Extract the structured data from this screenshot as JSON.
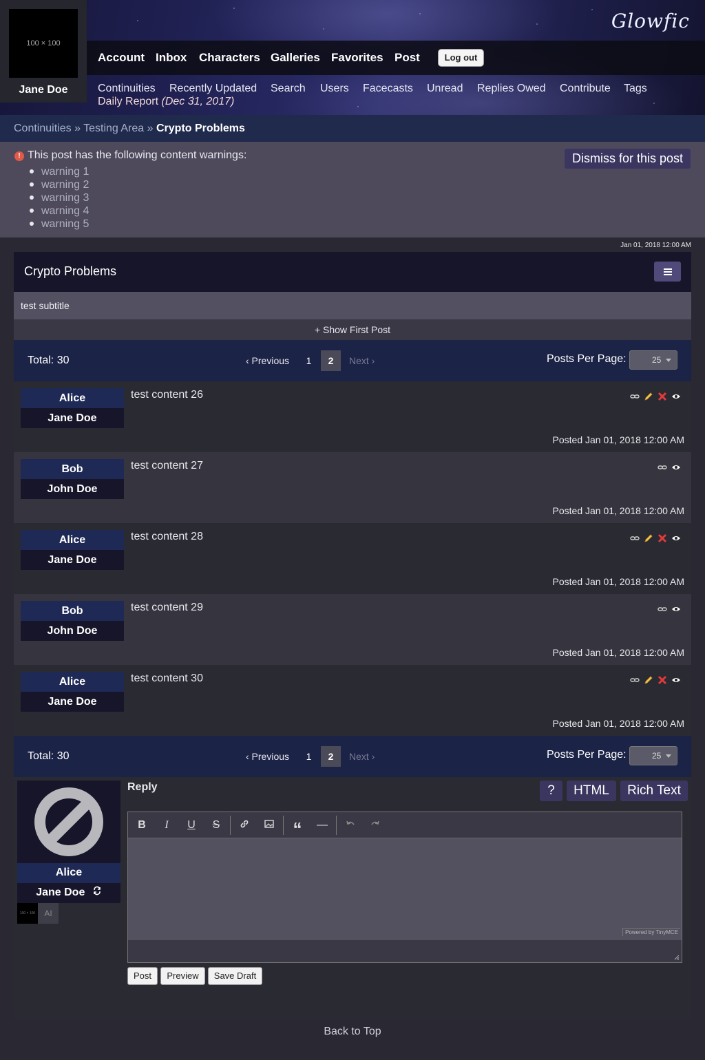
{
  "header": {
    "logo": "Glowfic",
    "avatar_placeholder": "100 × 100",
    "username": "Jane Doe",
    "main_nav": [
      "Account",
      "Inbox",
      "Characters",
      "Galleries",
      "Favorites",
      "Post"
    ],
    "logout_label": "Log out",
    "sub_nav": [
      "Continuities",
      "Recently Updated",
      "Search",
      "Users",
      "Facecasts",
      "Unread",
      "Replies Owed",
      "Contribute",
      "Tags"
    ],
    "daily_report": "Daily Report",
    "daily_report_date": "(Dec 31, 2017)"
  },
  "breadcrumb": {
    "items": [
      "Continuities",
      "Testing Area"
    ],
    "separator": "»",
    "current": "Crypto Problems"
  },
  "warnings": {
    "heading": "This post has the following content warnings:",
    "items": [
      "warning 1",
      "warning 2",
      "warning 3",
      "warning 4",
      "warning 5"
    ],
    "dismiss_label": "Dismiss for this post"
  },
  "post": {
    "date": "Jan 01, 2018 12:00 AM",
    "title": "Crypto Problems",
    "subtitle": "test subtitle",
    "show_first_post": "+ Show First Post"
  },
  "pagination": {
    "total": "Total: 30",
    "previous": "‹ Previous",
    "pages": [
      "1",
      "2"
    ],
    "current_page": "2",
    "next": "Next ›",
    "per_page_label": "Posts Per Page:",
    "per_page_value": "25"
  },
  "replies": [
    {
      "character": "Alice",
      "user": "Jane Doe",
      "content": "test content 26",
      "posted": "Posted Jan 01, 2018 12:00 AM",
      "own": true
    },
    {
      "character": "Bob",
      "user": "John Doe",
      "content": "test content 27",
      "posted": "Posted Jan 01, 2018 12:00 AM",
      "own": false
    },
    {
      "character": "Alice",
      "user": "Jane Doe",
      "content": "test content 28",
      "posted": "Posted Jan 01, 2018 12:00 AM",
      "own": true
    },
    {
      "character": "Bob",
      "user": "John Doe",
      "content": "test content 29",
      "posted": "Posted Jan 01, 2018 12:00 AM",
      "own": false
    },
    {
      "character": "Alice",
      "user": "Jane Doe",
      "content": "test content 30",
      "posted": "Posted Jan 01, 2018 12:00 AM",
      "own": true
    }
  ],
  "reply_form": {
    "label": "Reply",
    "character": "Alice",
    "user": "Jane Doe",
    "mini_avatar": "100 × 100",
    "ai_label": "AI",
    "help_label": "?",
    "html_label": "HTML",
    "rich_text_label": "Rich Text",
    "powered_by": "Powered by TinyMCE",
    "buttons": {
      "post": "Post",
      "preview": "Preview",
      "save_draft": "Save Draft"
    }
  },
  "footer": {
    "back_to_top": "Back to Top"
  },
  "colors": {
    "accent": "#3a3660",
    "nav_bar": "#1b2347",
    "character_bar": "#1e2a55",
    "warning_icon": "#e05a47"
  }
}
